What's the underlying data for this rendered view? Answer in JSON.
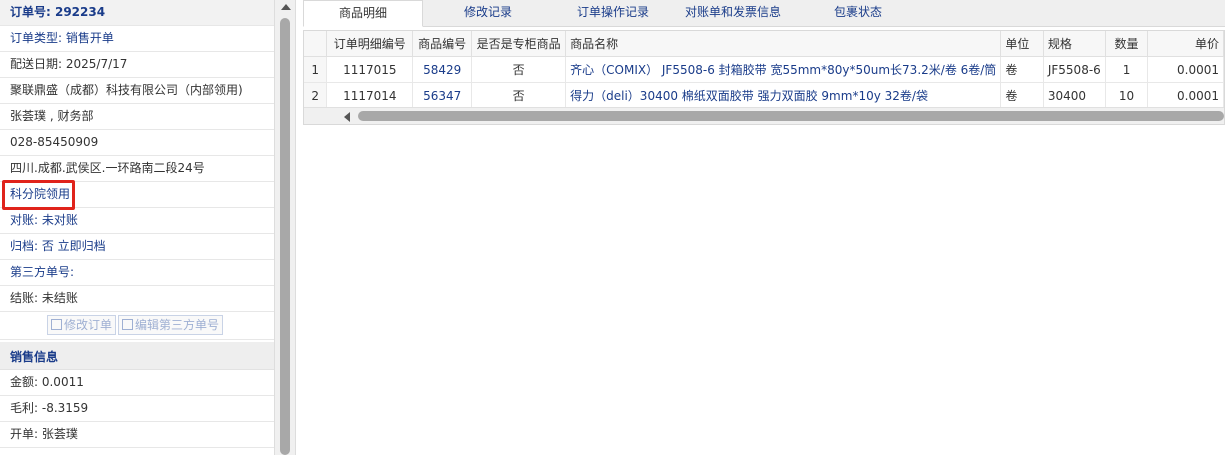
{
  "order": {
    "number_label": "订单号: 292234",
    "type": "订单类型: 销售开单",
    "delivery_date": "配送日期: 2025/7/17",
    "company": "聚联鼎盛（成都）科技有限公司（内部领用)",
    "contact": "张荟璞 , 财务部",
    "phone": "028-85450909",
    "address": "四川.成都.武侯区.一环路南二段24号",
    "department": "科分院领用",
    "reconcile": "对账: 未对账",
    "archive": "归档: 否 立即归档",
    "third_party": "第三方单号:",
    "settlement": "结账: 未结账",
    "edit_order_button": "修改订单",
    "edit_third_party_button": "编辑第三方单号"
  },
  "sales": {
    "title": "销售信息",
    "amount": "金额: 0.0011",
    "gross_profit": "毛利: -8.3159",
    "issuer": "开单: 张荟璞"
  },
  "tabs": [
    "商品明细",
    "修改记录",
    "订单操作记录",
    "对账单和发票信息",
    "包裹状态"
  ],
  "table": {
    "headers": [
      "订单明细编号",
      "商品编号",
      "是否是专柜商品",
      "商品名称",
      "单位",
      "规格",
      "数量",
      "单价"
    ],
    "rows": [
      {
        "n": "1",
        "detail_id": "1117015",
        "product_id": "58429",
        "counter": "否",
        "name": "齐心（COMIX） JF5508-6 封箱胶带 宽55mm*80y*50um长73.2米/卷 6卷/筒",
        "unit": "卷",
        "spec": "JF5508-6",
        "qty": "1",
        "price": "0.0001"
      },
      {
        "n": "2",
        "detail_id": "1117014",
        "product_id": "56347",
        "counter": "否",
        "name": "得力（deli）30400 棉纸双面胶带 强力双面胶 9mm*10y 32卷/袋",
        "unit": "卷",
        "spec": "30400",
        "qty": "10",
        "price": "0.0001"
      }
    ]
  }
}
